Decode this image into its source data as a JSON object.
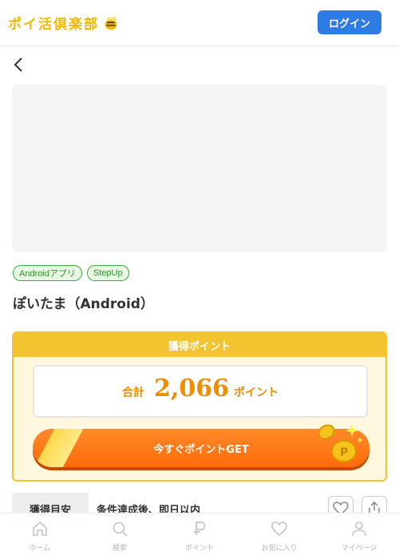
{
  "header": {
    "logo_text": "ポイ活倶楽部",
    "login_label": "ログイン"
  },
  "tags": [
    "Androidアプリ",
    "StepUp"
  ],
  "offer": {
    "title": "ぽいたま（Android）"
  },
  "points": {
    "header_label": "獲得ポイント",
    "total_label": "合計",
    "total_value": "2,066",
    "unit": "ポイント",
    "cta_label": "今すぐポイントGET"
  },
  "info": {
    "label": "獲得目安",
    "value": "条件達成後、即日以内"
  },
  "bottom_nav": [
    {
      "label": "ホーム",
      "icon": "home-icon"
    },
    {
      "label": "検索",
      "icon": "search-icon"
    },
    {
      "label": "ポイント",
      "icon": "point-icon"
    },
    {
      "label": "お気に入り",
      "icon": "heart-icon"
    },
    {
      "label": "マイページ",
      "icon": "user-icon"
    }
  ],
  "colors": {
    "brand_yellow": "#f4c430",
    "login_blue": "#2f7be5",
    "accent_orange": "#f08c00",
    "tag_green": "#3cae3c"
  }
}
